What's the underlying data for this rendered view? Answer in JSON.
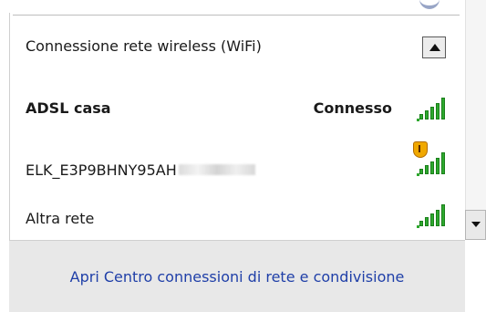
{
  "section": {
    "title": "Connessione rete wireless  (WiFi)",
    "collapse_icon": "up-arrow-icon"
  },
  "networks": [
    {
      "ssid": "ADSL casa",
      "status": "Connesso",
      "secured": false,
      "signal_bars": 5
    },
    {
      "ssid": "ELK_E3P9BHNY95AH",
      "status": "",
      "secured": true,
      "signal_bars": 5
    },
    {
      "ssid": "Altra rete",
      "status": "",
      "secured": false,
      "signal_bars": 5
    }
  ],
  "footer": {
    "link_text": "Apri Centro connessioni di rete e condivisione"
  },
  "colors": {
    "signal": "#2ea82e",
    "link": "#1f3fa8",
    "footer_bg": "#e8e8e8"
  }
}
